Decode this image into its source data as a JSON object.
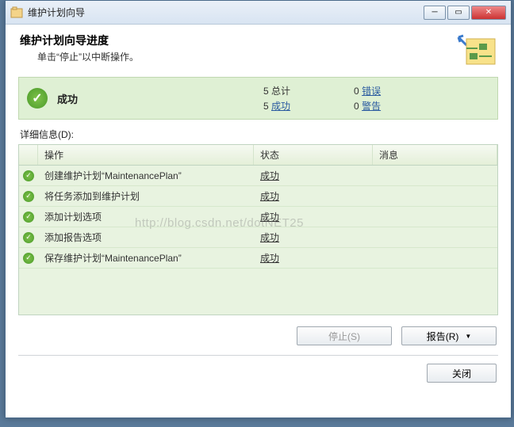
{
  "window": {
    "title": "维护计划向导"
  },
  "header": {
    "title": "维护计划向导进度",
    "subtitle": "单击“停止”以中断操作。"
  },
  "status": {
    "label": "成功",
    "total_count": "5",
    "total_label": "总计",
    "success_count": "5",
    "success_label": "成功",
    "error_count": "0",
    "error_label": "错误",
    "warning_count": "0",
    "warning_label": "警告"
  },
  "details": {
    "label": "详细信息(D):",
    "columns": {
      "action": "操作",
      "status": "状态",
      "message": "消息"
    },
    "rows": [
      {
        "action": "创建维护计划“MaintenancePlan”",
        "status": "成功",
        "message": ""
      },
      {
        "action": "将任务添加到维护计划",
        "status": "成功",
        "message": ""
      },
      {
        "action": "添加计划选项",
        "status": "成功",
        "message": ""
      },
      {
        "action": "添加报告选项",
        "status": "成功",
        "message": ""
      },
      {
        "action": "保存维护计划“MaintenancePlan”",
        "status": "成功",
        "message": ""
      }
    ]
  },
  "buttons": {
    "stop": "停止(S)",
    "report": "报告(R)",
    "close": "关闭"
  },
  "watermark": "http://blog.csdn.net/dotNET25"
}
